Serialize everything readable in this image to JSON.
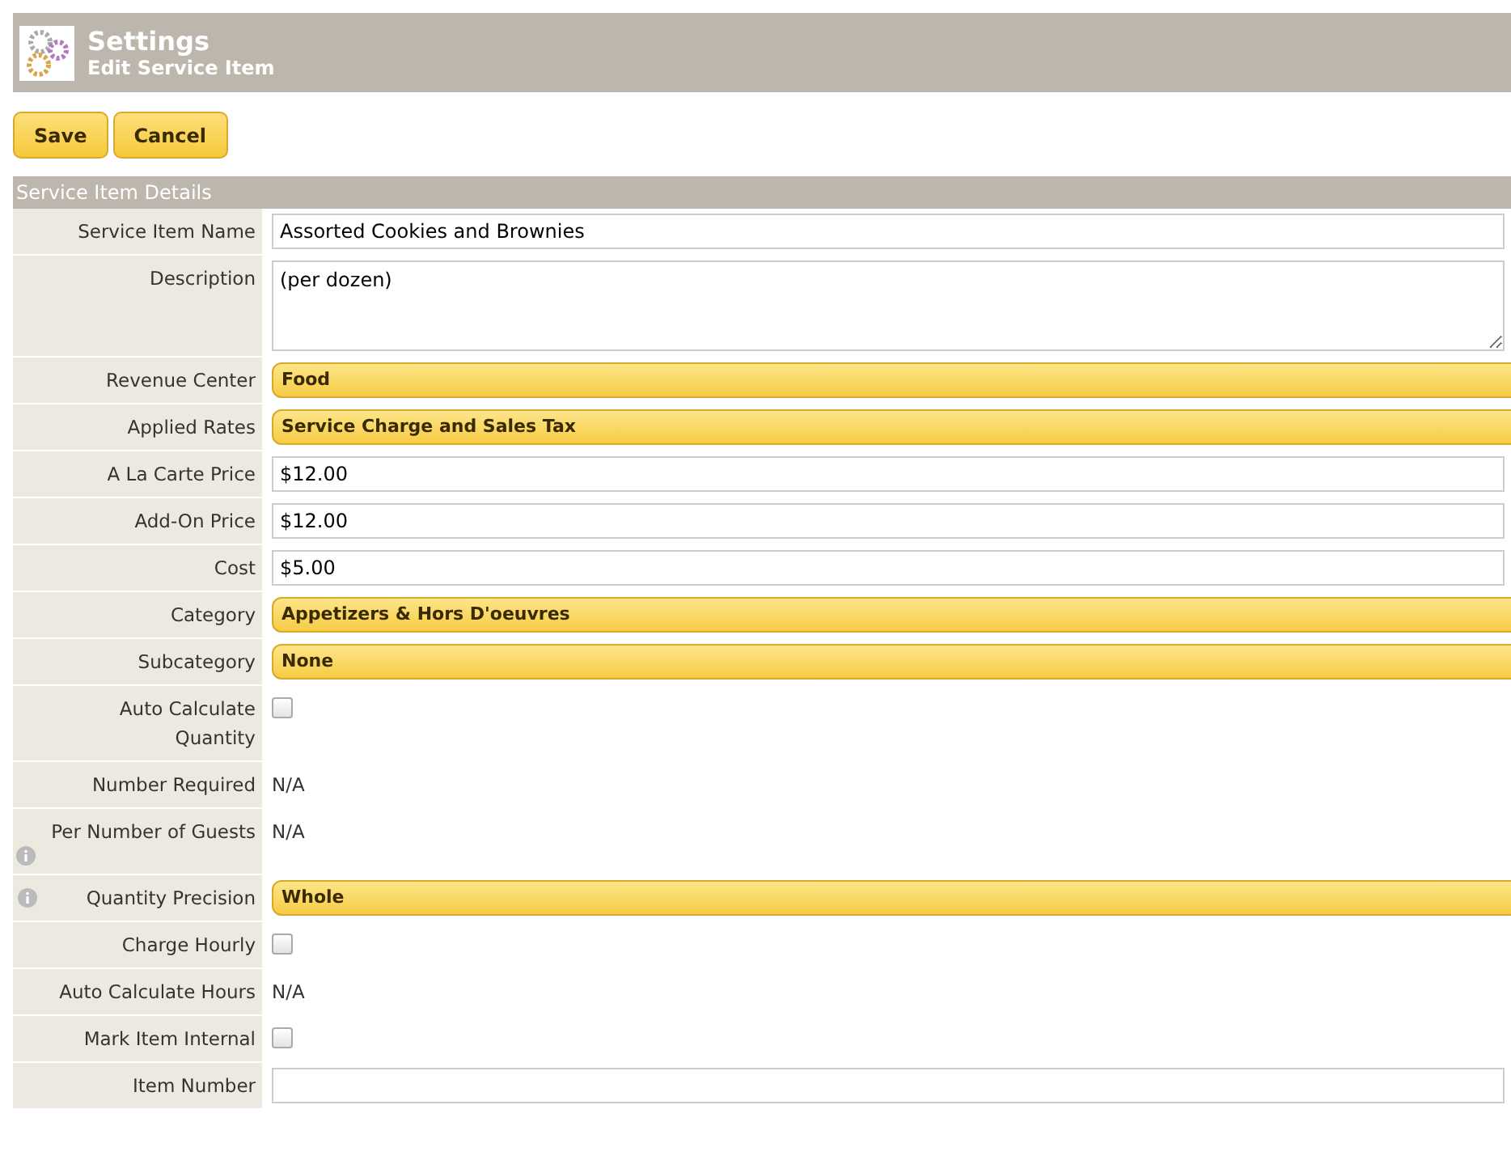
{
  "header": {
    "title": "Settings",
    "subtitle": "Edit Service Item"
  },
  "buttons": [
    "Save",
    "Cancel"
  ],
  "section": {
    "title": "Service Item Details"
  },
  "fields": [
    {
      "label": "Service Item Name",
      "kind": "text",
      "value": "Assorted Cookies and Brownies"
    },
    {
      "label": "Description",
      "kind": "textarea",
      "value": "(per dozen)"
    },
    {
      "label": "Revenue Center",
      "kind": "select",
      "value": "Food"
    },
    {
      "label": "Applied Rates",
      "kind": "select",
      "value": "Service Charge and Sales Tax"
    },
    {
      "label": "A La Carte Price",
      "kind": "text",
      "value": "$12.00"
    },
    {
      "label": "Add-On Price",
      "kind": "text",
      "value": "$12.00"
    },
    {
      "label": "Cost",
      "kind": "text",
      "value": "$5.00"
    },
    {
      "label": "Category",
      "kind": "select",
      "value": "Appetizers & Hors D'oeuvres"
    },
    {
      "label": "Subcategory",
      "kind": "select",
      "value": "None"
    },
    {
      "label": "Auto Calculate Quantity",
      "kind": "checkbox",
      "checked": false
    },
    {
      "label": "Number Required",
      "kind": "static",
      "value": "N/A"
    },
    {
      "label": "Per Number of Guests",
      "kind": "static",
      "value": "N/A",
      "info_below": true
    },
    {
      "label": "Quantity Precision",
      "kind": "select",
      "value": "Whole",
      "info_before": true
    },
    {
      "label": "Charge Hourly",
      "kind": "checkbox",
      "checked": false
    },
    {
      "label": "Auto Calculate Hours",
      "kind": "static",
      "value": "N/A"
    },
    {
      "label": "Mark Item Internal",
      "kind": "checkbox",
      "checked": false
    },
    {
      "label": "Item Number",
      "kind": "text"
    }
  ]
}
